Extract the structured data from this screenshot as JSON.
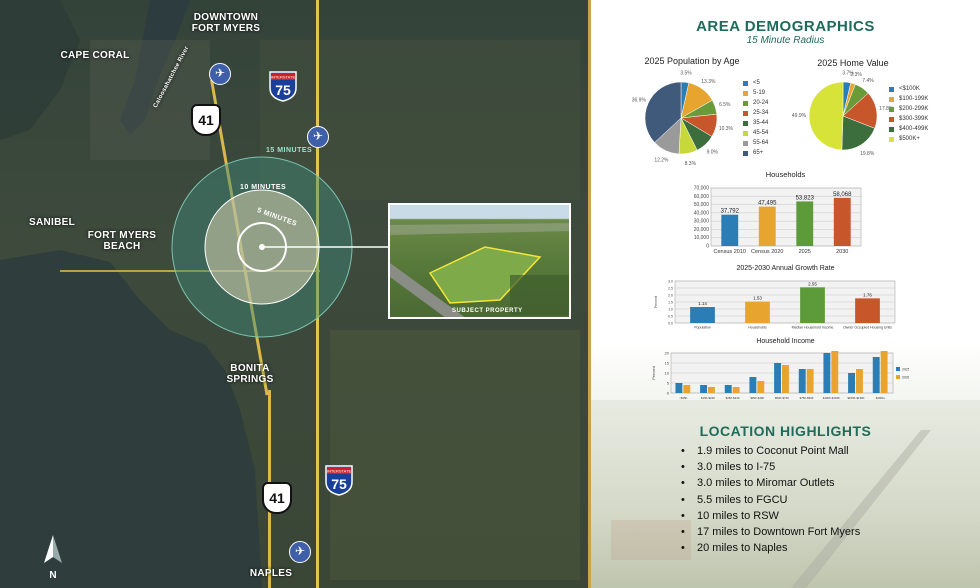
{
  "map": {
    "labels": {
      "downtown": "DOWNTOWN\nFORT MYERS",
      "cape_coral": "CAPE CORAL",
      "sanibel": "SANIBEL",
      "fort_myers_beach": "FORT MYERS\nBEACH",
      "bonita_springs": "BONITA\nSPRINGS",
      "naples": "NAPLES",
      "river": "Caloosahatchee River"
    },
    "ring_labels": {
      "r15": "15 MINUTES",
      "r10": "10 MINUTES",
      "r5": "5 MINUTES"
    },
    "shields": {
      "us41": "41",
      "i75": "75",
      "interstate": "INTERSTATE"
    },
    "inset_caption": "SUBJECT PROPERTY",
    "compass": "N"
  },
  "panel": {
    "title": "AREA DEMOGRAPHICS",
    "subtitle": "15 Minute Radius",
    "highlights_title": "LOCATION HIGHLIGHTS",
    "highlights": [
      "1.9 miles to Coconut Point Mall",
      "3.0 miles to I-75",
      "3.0 miles to Miromar Outlets",
      "5.5 miles to FGCU",
      "10 miles to RSW",
      "17 miles to Downtown Fort Myers",
      "20 miles to Naples"
    ]
  },
  "chart_data": [
    {
      "type": "pie",
      "title": "2025 Population by Age",
      "categories": [
        "<5",
        "5-19",
        "20-24",
        "25-34",
        "35-44",
        "45-54",
        "55-64",
        "65+"
      ],
      "values": [
        3.5,
        13.3,
        6.5,
        10.3,
        9.0,
        8.3,
        12.2,
        36.9
      ],
      "colors": [
        "#2a7db5",
        "#e7a530",
        "#6b9a3a",
        "#c8562b",
        "#3b6e3c",
        "#c7d93a",
        "#9a9a9a",
        "#3f5a7a"
      ]
    },
    {
      "type": "pie",
      "title": "2025 Home Value",
      "categories": [
        "<$100K",
        "$100-199K",
        "$200-299K",
        "$300-399K",
        "$400-499K",
        "$500K+"
      ],
      "values": [
        3.7,
        2.3,
        7.4,
        17.8,
        19.8,
        49.9
      ],
      "colors": [
        "#2a7db5",
        "#e7a530",
        "#6b9a3a",
        "#c8562b",
        "#3b6e3c",
        "#d8e33a"
      ]
    },
    {
      "type": "bar",
      "title": "Households",
      "categories": [
        "Census 2010",
        "Census 2020",
        "2025",
        "2030"
      ],
      "values": [
        37792,
        47495,
        53823,
        58068
      ],
      "labels": [
        "37,792",
        "47,495",
        "53,823",
        "58,068"
      ],
      "colors": [
        "#2a7db5",
        "#e7a530",
        "#5d9a3a",
        "#c8562b"
      ],
      "ylim": [
        0,
        70000
      ],
      "yticks": [
        "70,000",
        "60,000",
        "50,000",
        "40,000",
        "30,000",
        "20,000",
        "10,000",
        "0"
      ]
    },
    {
      "type": "bar",
      "title": "2025-2030 Annual Growth Rate",
      "ylabel": "Percent",
      "categories": [
        "Population",
        "Households",
        "Median Household Income",
        "Owner Occupied Housing Units"
      ],
      "values": [
        1.14,
        1.53,
        2.55,
        1.76
      ],
      "labels": [
        "1.14",
        "1.53",
        "2.55",
        "1.76"
      ],
      "colors": [
        "#2a7db5",
        "#e7a530",
        "#5d9a3a",
        "#c8562b"
      ],
      "ylim": [
        0,
        3.0
      ],
      "yticks": [
        "3.0",
        "2.5",
        "2.0",
        "1.5",
        "1.0",
        "0.5",
        "0.0"
      ]
    },
    {
      "type": "bar",
      "title": "Household Income",
      "ylabel": "Percent",
      "categories": [
        "<$15K",
        "$15K-$24K",
        "$25K-$34K",
        "$35K-$49K",
        "$50K-$74K",
        "$75K-$99K",
        "$100K-$149K",
        "$150K-$199K",
        "$200K+"
      ],
      "series": [
        {
          "name": "2025",
          "values": [
            5,
            4,
            4,
            8,
            15,
            12,
            20,
            10,
            18
          ],
          "color": "#2a7db5"
        },
        {
          "name": "2030",
          "values": [
            4,
            3,
            3,
            6,
            14,
            12,
            21,
            12,
            21
          ],
          "color": "#e7a530"
        }
      ],
      "ylim": [
        0,
        20
      ],
      "yticks": [
        "20",
        "15",
        "10",
        "5",
        "0"
      ]
    }
  ]
}
